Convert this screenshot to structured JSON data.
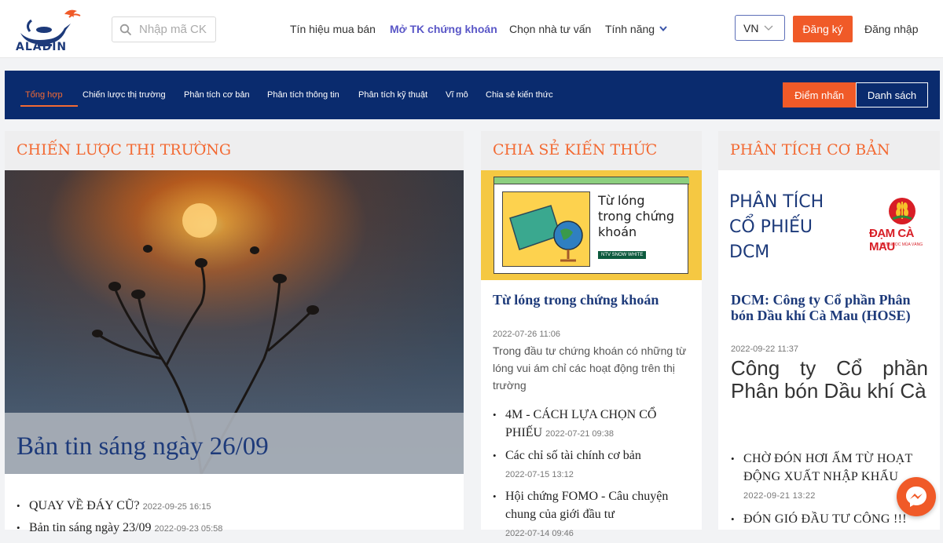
{
  "brand": {
    "name": "ALADIN",
    "colors": {
      "orange": "#f05a28",
      "navy": "#0a2b6e",
      "title_blue": "#1d3a7a"
    }
  },
  "search": {
    "placeholder": "Nhập mã CK"
  },
  "topnav": {
    "items": [
      {
        "label": "Tín hiệu mua bán"
      },
      {
        "label": "Mở TK chứng khoán",
        "active": true
      },
      {
        "label": "Chọn nhà tư vấn"
      },
      {
        "label": "Tính năng"
      }
    ],
    "lang": "VN",
    "register": "Đăng ký",
    "login": "Đăng nhập"
  },
  "categories": {
    "tabs": [
      {
        "label": "Tổng hợp",
        "active": true
      },
      {
        "label": "Chiến lược thị trường"
      },
      {
        "label": "Phân tích cơ bản"
      },
      {
        "label": "Phân tích thông tin"
      },
      {
        "label": "Phân tích kỹ thuật"
      },
      {
        "label": "Vĩ mô"
      },
      {
        "label": "Chia sẻ kiến thức"
      }
    ],
    "highlight_btn": "Điểm nhấn",
    "list_btn": "Danh sách"
  },
  "col1": {
    "heading": "CHIẾN LƯỢC THỊ TRƯỜNG",
    "feature_title": "Bản tin sáng ngày 26/09",
    "list": [
      {
        "title": "QUAY VỀ ĐÁY CŨ?",
        "date": "2022-09-25 16:15"
      },
      {
        "title": "Bản tin sáng ngày 23/09",
        "date": "2022-09-23 05:58"
      }
    ]
  },
  "col2": {
    "heading": "CHIA SẺ KIẾN THỨC",
    "image_text": [
      "Từ lóng",
      "trong chứng",
      "khoán"
    ],
    "image_tag": "NTV SNOW WHITE",
    "title": "Từ lóng trong chứng khoán",
    "date": "2022-07-26 11:06",
    "excerpt": "Trong đầu tư chứng khoán có những từ lóng vui ám chỉ các hoạt động trên thị trường",
    "list": [
      {
        "title": "4M - CÁCH LỰA CHỌN CỔ PHIẾU",
        "date": "2022-07-21 09:38"
      },
      {
        "title": "Các chỉ số tài chính cơ bản",
        "date": "2022-07-15 13:12"
      },
      {
        "title": "Hội chứng FOMO - Câu chuyện chung của giới đầu tư",
        "date": "2022-07-14 09:46"
      }
    ]
  },
  "col3": {
    "heading": "PHÂN TÍCH CƠ BẢN",
    "image_text": [
      "PHÂN TÍCH",
      "CỔ PHIẾU",
      "DCM"
    ],
    "image_logo": "ĐẠM CÀ MAU",
    "image_logo_sub": "HẠT NGỌC MÙA VÀNG",
    "title": "DCM: Công ty Cổ phần Phân bón Dầu khí Cà Mau (HOSE)",
    "date": "2022-09-22 11:37",
    "excerpt": "Công ty Cổ phần Phân bón Dầu khí Cà",
    "list": [
      {
        "title": "CHỜ ĐÓN HƠI ẤM TỪ HOẠT ĐỘNG XUẤT NHẬP KHẨU",
        "date": "2022-09-21 13:22"
      },
      {
        "title": "ĐÓN GIÓ ĐẦU TƯ CÔNG !!!",
        "date": ""
      }
    ]
  }
}
